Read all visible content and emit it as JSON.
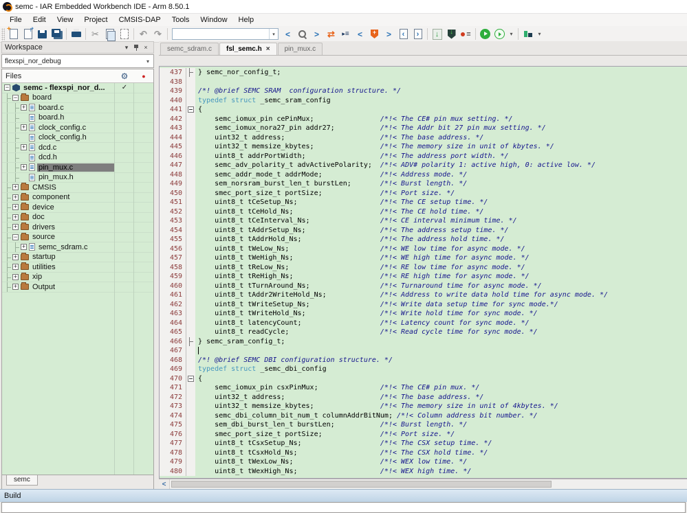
{
  "window": {
    "title": "semc - IAR Embedded Workbench IDE - Arm 8.50.1"
  },
  "menu": {
    "items": [
      "File",
      "Edit",
      "View",
      "Project",
      "CMSIS-DAP",
      "Tools",
      "Window",
      "Help"
    ]
  },
  "toolbar": {
    "search_value": "",
    "icons": [
      "new-doc",
      "open-doc",
      "save",
      "save-all",
      "sep",
      "print",
      "sep",
      "cut",
      "copy",
      "paste",
      "sep",
      "undo",
      "redo",
      "sep",
      "search-box",
      "find-prev",
      "find",
      "find-next",
      "replace",
      "bookmark-list",
      "nav-prev",
      "breakpoint-shield",
      "nav-next",
      "doc-prev",
      "doc-next",
      "sep",
      "download",
      "download-debug",
      "breakpoint-list",
      "sep",
      "run",
      "run-alt",
      "dropdown",
      "sep",
      "build-config",
      "dropdown"
    ]
  },
  "workspace": {
    "title": "Workspace",
    "config": "flexspi_nor_debug",
    "files_header": "Files",
    "bottom_tab": "semc",
    "tree": [
      {
        "label": "semc - flexspi_nor_d...",
        "icon": "project",
        "depth": 0,
        "expand": "minus",
        "check": "✓",
        "bold": true
      },
      {
        "label": "board",
        "icon": "folder",
        "depth": 1,
        "expand": "minus"
      },
      {
        "label": "board.c",
        "icon": "file",
        "depth": 2,
        "expand": "plus"
      },
      {
        "label": "board.h",
        "icon": "file",
        "depth": 2
      },
      {
        "label": "clock_config.c",
        "icon": "file",
        "depth": 2,
        "expand": "plus"
      },
      {
        "label": "clock_config.h",
        "icon": "file",
        "depth": 2
      },
      {
        "label": "dcd.c",
        "icon": "file",
        "depth": 2,
        "expand": "plus"
      },
      {
        "label": "dcd.h",
        "icon": "file",
        "depth": 2
      },
      {
        "label": "pin_mux.c",
        "icon": "file",
        "depth": 2,
        "expand": "plus",
        "selected": true
      },
      {
        "label": "pin_mux.h",
        "icon": "file",
        "depth": 2
      },
      {
        "label": "CMSIS",
        "icon": "folder",
        "depth": 1,
        "expand": "plus"
      },
      {
        "label": "component",
        "icon": "folder",
        "depth": 1,
        "expand": "plus"
      },
      {
        "label": "device",
        "icon": "folder",
        "depth": 1,
        "expand": "plus"
      },
      {
        "label": "doc",
        "icon": "folder",
        "depth": 1,
        "expand": "plus"
      },
      {
        "label": "drivers",
        "icon": "folder",
        "depth": 1,
        "expand": "plus"
      },
      {
        "label": "source",
        "icon": "folder",
        "depth": 1,
        "expand": "minus"
      },
      {
        "label": "semc_sdram.c",
        "icon": "file",
        "depth": 2,
        "expand": "plus"
      },
      {
        "label": "startup",
        "icon": "folder",
        "depth": 1,
        "expand": "plus"
      },
      {
        "label": "utilities",
        "icon": "folder",
        "depth": 1,
        "expand": "plus"
      },
      {
        "label": "xip",
        "icon": "folder",
        "depth": 1,
        "expand": "plus"
      },
      {
        "label": "Output",
        "icon": "folder",
        "depth": 1,
        "expand": "plus"
      }
    ]
  },
  "editor": {
    "tabs": [
      {
        "label": "semc_sdram.c",
        "active": false
      },
      {
        "label": "fsl_semc.h",
        "active": true,
        "closable": true
      },
      {
        "label": "pin_mux.c",
        "active": false
      }
    ],
    "comment_column": 44,
    "lines": [
      {
        "n": 437,
        "fold": "end",
        "code": "} semc_nor_config_t;"
      },
      {
        "n": 438
      },
      {
        "n": 439,
        "comment": "/*! @brief SEMC SRAM  configuration structure. */"
      },
      {
        "n": 440,
        "kw": "typedef struct",
        "code": " _semc_sram_config"
      },
      {
        "n": 441,
        "fold": "open",
        "code": "{"
      },
      {
        "n": 442,
        "code": "    semc_iomux_pin cePinMux;",
        "comment": "/*!< The CE# pin mux setting. */"
      },
      {
        "n": 443,
        "code": "    semc_iomux_nora27_pin addr27;",
        "comment": "/*!< The Addr bit 27 pin mux setting. */"
      },
      {
        "n": 444,
        "code": "    uint32_t address;",
        "comment": "/*!< The base address. */"
      },
      {
        "n": 445,
        "code": "    uint32_t memsize_kbytes;",
        "comment": "/*!< The memory size in unit of kbytes. */"
      },
      {
        "n": 446,
        "code": "    uint8_t addrPortWidth;",
        "comment": "/*!< The address port width. */"
      },
      {
        "n": 447,
        "code": "    semc_adv_polarity_t advActivePolarity;",
        "comment": "/*!< ADV# polarity 1: active high, 0: active low. */"
      },
      {
        "n": 448,
        "code": "    semc_addr_mode_t addrMode;",
        "comment": "/*!< Address mode. */"
      },
      {
        "n": 449,
        "code": "    sem_norsram_burst_len_t burstLen;",
        "comment": "/*!< Burst length. */"
      },
      {
        "n": 450,
        "code": "    smec_port_size_t portSize;",
        "comment": "/*!< Port size. */"
      },
      {
        "n": 451,
        "code": "    uint8_t tCeSetup_Ns;",
        "comment": "/*!< The CE setup time. */"
      },
      {
        "n": 452,
        "code": "    uint8_t tCeHold_Ns;",
        "comment": "/*!< The CE hold time. */"
      },
      {
        "n": 453,
        "code": "    uint8_t tCeInterval_Ns;",
        "comment": "/*!< CE interval minimum time. */"
      },
      {
        "n": 454,
        "code": "    uint8_t tAddrSetup_Ns;",
        "comment": "/*!< The address setup time. */"
      },
      {
        "n": 455,
        "code": "    uint8_t tAddrHold_Ns;",
        "comment": "/*!< The address hold time. */"
      },
      {
        "n": 456,
        "code": "    uint8_t tWeLow_Ns;",
        "comment": "/*!< WE low time for async mode. */"
      },
      {
        "n": 457,
        "code": "    uint8_t tWeHigh_Ns;",
        "comment": "/*!< WE high time for async mode. */"
      },
      {
        "n": 458,
        "code": "    uint8_t tReLow_Ns;",
        "comment": "/*!< RE low time for async mode. */"
      },
      {
        "n": 459,
        "code": "    uint8_t tReHigh_Ns;",
        "comment": "/*!< RE high time for async mode. */"
      },
      {
        "n": 460,
        "code": "    uint8_t tTurnAround_Ns;",
        "comment": "/*!< Turnaround time for async mode. */"
      },
      {
        "n": 461,
        "code": "    uint8_t tAddr2WriteHold_Ns;",
        "comment": "/*!< Address to write data hold time for async mode. */"
      },
      {
        "n": 462,
        "code": "    uint8_t tWriteSetup_Ns;",
        "comment": "/*!< Write data setup time for sync mode.*/"
      },
      {
        "n": 463,
        "code": "    uint8_t tWriteHold_Ns;",
        "comment": "/*!< Write hold time for sync mode. */"
      },
      {
        "n": 464,
        "code": "    uint8_t latencyCount;",
        "comment": "/*!< Latency count for sync mode. */"
      },
      {
        "n": 465,
        "code": "    uint8_t readCycle;",
        "comment": "/*!< Read cycle time for sync mode. */"
      },
      {
        "n": 466,
        "fold": "end",
        "code": "} semc_sram_config_t;"
      },
      {
        "n": 467,
        "cursor": true
      },
      {
        "n": 468,
        "comment": "/*! @brief SEMC DBI configuration structure. */"
      },
      {
        "n": 469,
        "kw": "typedef struct",
        "code": " _semc_dbi_config"
      },
      {
        "n": 470,
        "fold": "open",
        "code": "{"
      },
      {
        "n": 471,
        "code": "    semc_iomux_pin csxPinMux;",
        "comment": "/*!< The CE# pin mux. */"
      },
      {
        "n": 472,
        "code": "    uint32_t address;",
        "comment": "/*!< The base address. */"
      },
      {
        "n": 473,
        "code": "    uint32_t memsize_kbytes;",
        "comment": "/*!< The memory size in unit of 4kbytes. */"
      },
      {
        "n": 474,
        "code": "    semc_dbi_column_bit_num_t columnAddrBitNum;",
        "comment": "/*!< Column address bit number. */"
      },
      {
        "n": 475,
        "code": "    sem_dbi_burst_len_t burstLen;",
        "comment": "/*!< Burst length. */"
      },
      {
        "n": 476,
        "code": "    smec_port_size_t portSize;",
        "comment": "/*!< Port size. */"
      },
      {
        "n": 477,
        "code": "    uint8_t tCsxSetup_Ns;",
        "comment": "/*!< The CSX setup time. */"
      },
      {
        "n": 478,
        "code": "    uint8_t tCsxHold_Ns;",
        "comment": "/*!< The CSX hold time. */"
      },
      {
        "n": 479,
        "code": "    uint8_t tWexLow_Ns;",
        "comment": "/*!< WEX low time. */"
      },
      {
        "n": 480,
        "code": "    uint8_t tWexHigh_Ns;",
        "comment": "/*!< WEX high time. */"
      }
    ]
  },
  "build": {
    "title": "Build"
  },
  "colors": {
    "editor_bg": "#d5ecd3",
    "line_number": "#8b3a3a",
    "keyword": "#4596be",
    "comment": "#14148c",
    "selection_bg": "#7e7e7e",
    "folder_icon": "#b97a3e",
    "run_green": "#2eae3c",
    "shield_orange": "#e8641b"
  }
}
